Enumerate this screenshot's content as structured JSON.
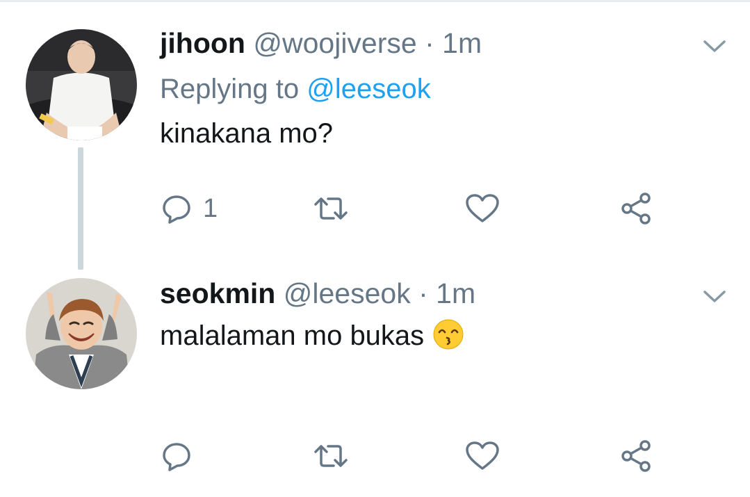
{
  "tweets": [
    {
      "name": "jihoon",
      "handle": "@woojiverse",
      "separator": "·",
      "time": "1m",
      "replying_prefix": "Replying to",
      "replying_to": "@leeseok",
      "text": "kinakana mo?",
      "reply_count": "1",
      "icons": [
        "chevron-down-icon",
        "reply-icon",
        "retweet-icon",
        "like-icon",
        "share-icon"
      ]
    },
    {
      "name": "seokmin",
      "handle": "@leeseok",
      "separator": "·",
      "time": "1m",
      "text": "malalaman mo bukas",
      "reply_count": "",
      "emoji": "kissing-face-smiling-eyes",
      "icons": [
        "chevron-down-icon",
        "reply-icon",
        "retweet-icon",
        "like-icon",
        "share-icon"
      ]
    }
  ],
  "colors": {
    "name": "#14171a",
    "muted": "#657786",
    "mention": "#1da1f2",
    "thread_line": "#ccd6dd"
  }
}
